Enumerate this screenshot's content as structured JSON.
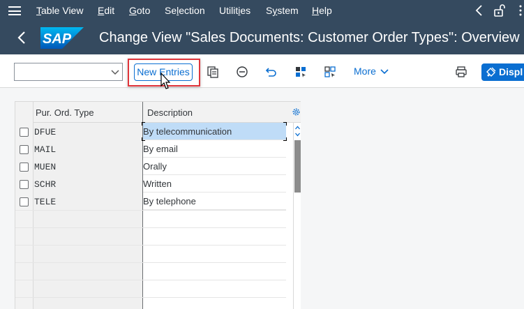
{
  "menubar": {
    "items": [
      {
        "label": "Table View",
        "underline": "T",
        "rest": "able View"
      },
      {
        "label": "Edit",
        "underline": "E",
        "rest": "dit"
      },
      {
        "label": "Goto",
        "underline": "G",
        "rest": "oto"
      },
      {
        "label": "Selection",
        "underline": "l",
        "before": "Se",
        "rest": "ection"
      },
      {
        "label": "Utilities",
        "underline": "i",
        "before": "Utilit",
        "rest": "es"
      },
      {
        "label": "System",
        "underline": "y",
        "before": "S",
        "rest": "stem"
      },
      {
        "label": "Help",
        "underline": "H",
        "rest": "elp"
      }
    ]
  },
  "titlebar": {
    "logo_text": "SAP",
    "title": "Change View \"Sales Documents: Customer Order Types\": Overview"
  },
  "toolbar": {
    "combo_value": "",
    "new_entries_label": "New Entries",
    "more_label": "More",
    "display_label": "Displ"
  },
  "table": {
    "headers": {
      "key": "Pur. Ord. Type",
      "description": "Description"
    },
    "rows": [
      {
        "key": "DFUE",
        "description": "By telecommunication",
        "selected": true
      },
      {
        "key": "MAIL",
        "description": "By email",
        "selected": false
      },
      {
        "key": "MUEN",
        "description": "Orally",
        "selected": false
      },
      {
        "key": "SCHR",
        "description": "Written",
        "selected": false
      },
      {
        "key": "TELE",
        "description": "By telephone",
        "selected": false
      }
    ]
  },
  "colors": {
    "shell": "#354a5f",
    "accent": "#0a6ed1",
    "highlight": "#e0353b",
    "selected_cell": "#bfdcf7"
  },
  "icons": [
    "menu-icon",
    "back-icon",
    "unlock-icon",
    "more-vertical-icon",
    "copy-icon",
    "delete-icon",
    "undo-icon",
    "select-block-icon",
    "select-all-icon",
    "chevron-down-icon",
    "print-icon",
    "display-icon",
    "table-settings-icon",
    "mouse-pointer-icon"
  ]
}
